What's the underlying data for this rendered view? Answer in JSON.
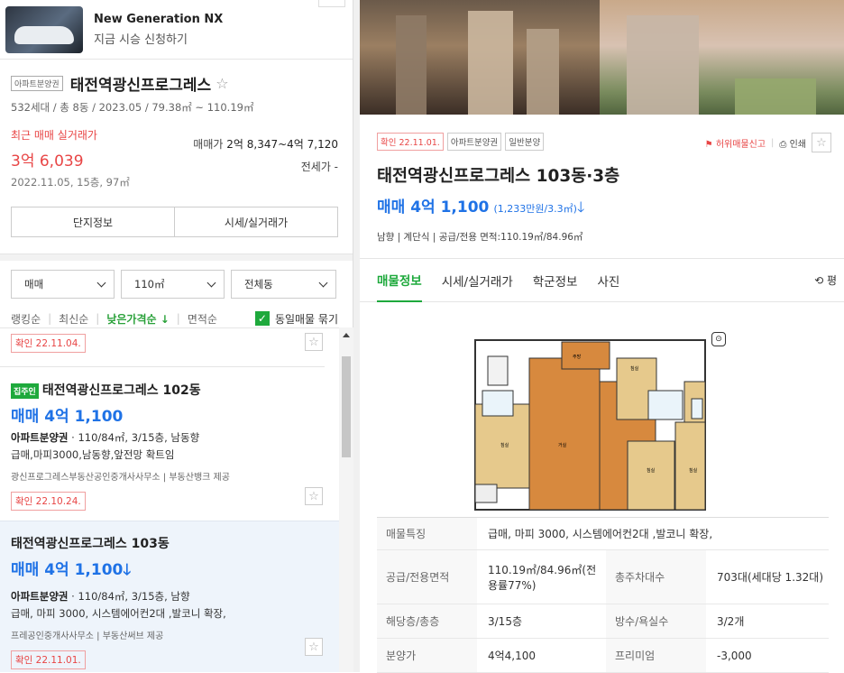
{
  "ad": {
    "title": "New Generation NX",
    "subtitle": "지금 시승 신청하기"
  },
  "complex": {
    "tag": "아파트분양권",
    "name": "태전역광신프로그레스",
    "star": "☆",
    "meta": "532세대 / 총 8동 / 2023.05 / 79.38㎡ ~ 110.19㎡",
    "recent_label": "최근 매매 실거래가",
    "recent_price": "3억 6,039",
    "recent_date": "2022.11.05, 15층, 97㎡",
    "range_label": "매매가",
    "range_value": "2억 8,347~4억 7,120",
    "jeonse": "전세가 -"
  },
  "tabs": [
    "단지정보",
    "시세/실거래가"
  ],
  "filters": [
    "매매",
    "110㎡",
    "전체동"
  ],
  "sorts": [
    "랭킹순",
    "최신순",
    "낮은가격순",
    "면적순"
  ],
  "group_label": "동일매물 묶기",
  "items": [
    {
      "confirm": "확인 22.11.04."
    },
    {
      "owner": "집주인",
      "title": "태전역광신프로그레스 102동",
      "price": "매매 4억 1,100",
      "type": "아파트분양권",
      "spec": "110/84㎡, 3/15층, 남동향",
      "desc": "급매,마피3000,남동향,앞전망 확트임",
      "agent": "광신프로그레스부동산공인중개사사무소",
      "provider": "부동산뱅크 제공",
      "confirm": "확인 22.10.24."
    },
    {
      "title": "태전역광신프로그레스 103동",
      "price": "매매 4억 1,100",
      "type": "아파트분양권",
      "spec": "110/84㎡, 3/15층, 남향",
      "desc": "급매, 마피 3000, 시스템에어컨2대 ,발코니 확장,",
      "agent": "프레공인중개사사무소",
      "provider": "부동산써브 제공",
      "confirm": "확인 22.11.01."
    }
  ],
  "detail": {
    "tags": [
      "확인 22.11.01.",
      "아파트분양권",
      "일반분양"
    ],
    "report": "허위매물신고",
    "print": "인쇄",
    "title": "태전역광신프로그레스 103동·3층",
    "price": "매매 4억 1,100",
    "price_per": "(1,233만원/3.3㎡)",
    "info": "남향 | 계단식 | 공급/전용 면적:110.19㎡/84.96㎡",
    "tabs": [
      "매물정보",
      "시세/실거래가",
      "학군정보",
      "사진"
    ],
    "unit_toggle": "평",
    "table": [
      {
        "k": "매물특징",
        "v": "급매, 마피 3000, 시스템에어컨2대 ,발코니 확장,"
      },
      {
        "k": "공급/전용면적",
        "v": "110.19㎡/84.96㎡(전용률77%)",
        "k2": "총주차대수",
        "v2": "703대(세대당 1.32대)"
      },
      {
        "k": "해당층/총층",
        "v": "3/15층",
        "k2": "방수/욕실수",
        "v2": "3/2개"
      },
      {
        "k": "분양가",
        "v": "4억4,100",
        "k2": "프리미엄",
        "v2": "-3,000"
      }
    ],
    "plan_labels": [
      "발코니",
      "주방/식당",
      "드레스룸",
      "욕실",
      "침실",
      "거실",
      "침실",
      "침실",
      "현관"
    ]
  }
}
